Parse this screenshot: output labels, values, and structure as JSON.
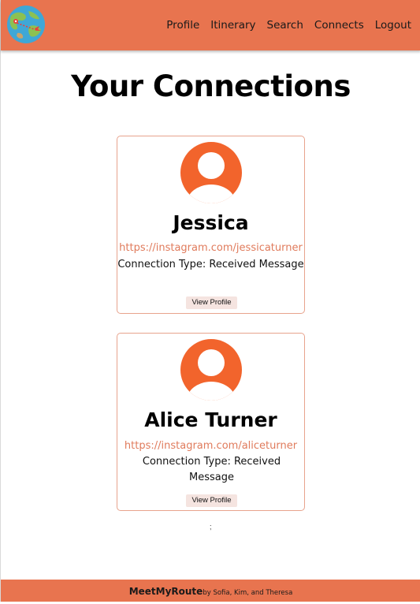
{
  "header": {
    "nav": {
      "profile": "Profile",
      "itinerary": "Itinerary",
      "search": "Search",
      "connects": "Connects",
      "logout": "Logout"
    }
  },
  "main": {
    "title": "Your Connections",
    "connections": [
      {
        "name": "Jessica",
        "instagram": "https://instagram.com/jessicaturner",
        "connection_type": "Connection Type: Received Message",
        "button_label": "View Profile"
      },
      {
        "name": "Alice Turner",
        "instagram": "https://instagram.com/aliceturner",
        "connection_type": "Connection Type: Received Message",
        "button_label": "View Profile"
      }
    ],
    "trailing_text": ";"
  },
  "footer": {
    "brand": "MeetMyRoute",
    "credit": "by Sofia, Kim, and Theresa"
  },
  "colors": {
    "brand": "#e8744f",
    "avatar": "#f2642c",
    "link": "#e07b5c",
    "card_border": "#e8a38d",
    "button_bg": "#f5e4e0"
  }
}
